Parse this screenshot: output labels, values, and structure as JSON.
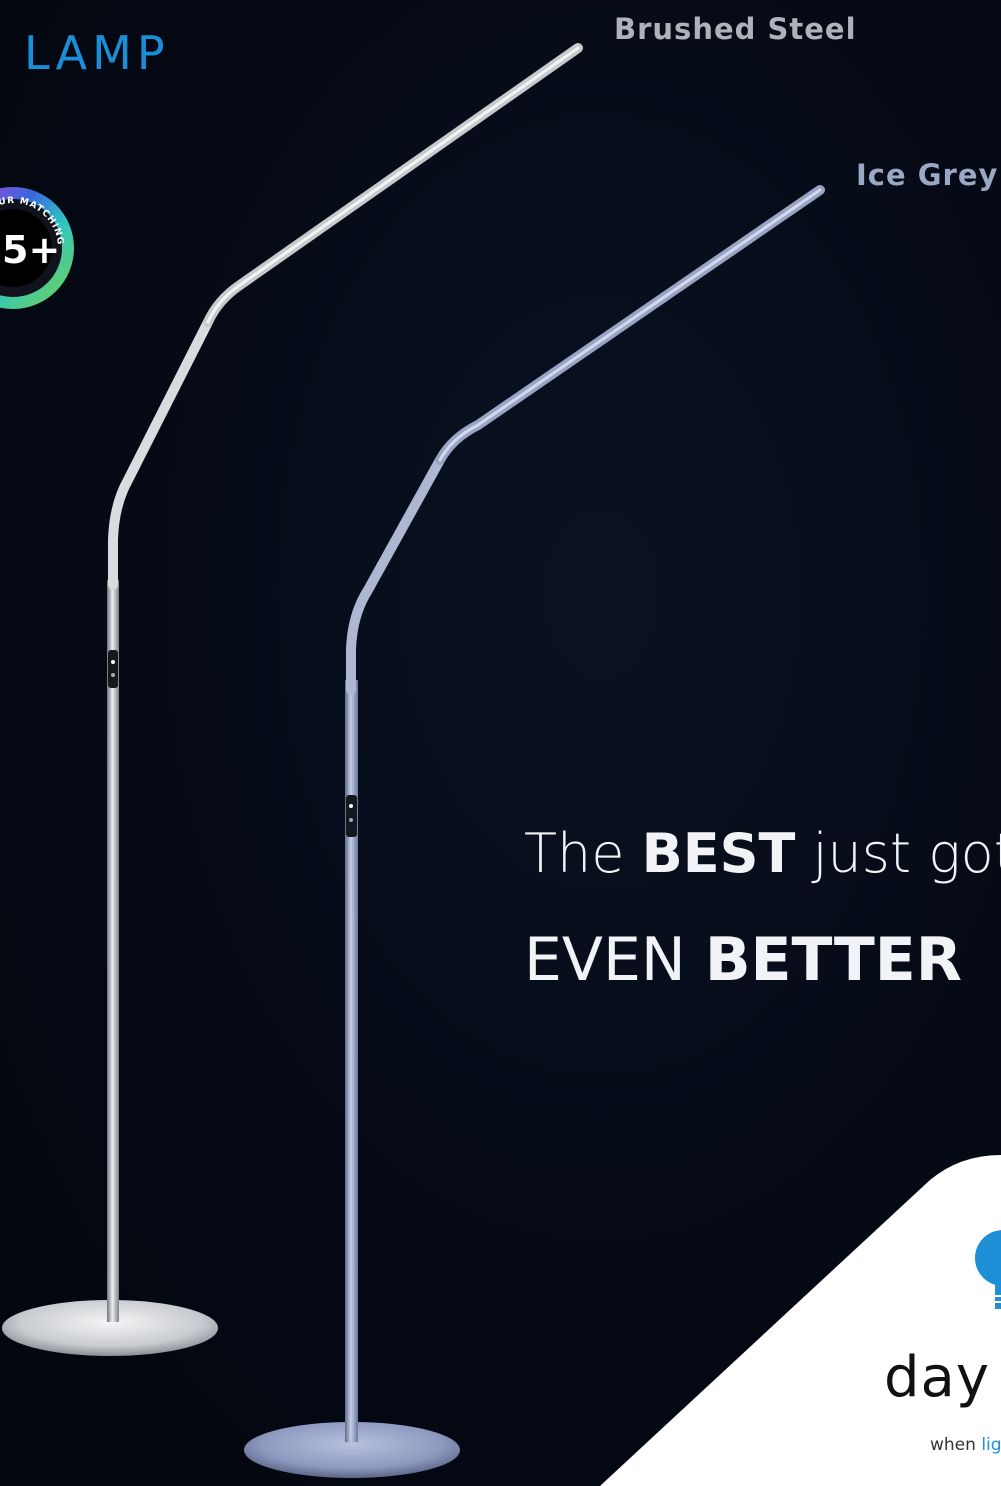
{
  "header": {
    "title": "LAMP"
  },
  "finishes": [
    {
      "label": "Brushed Steel"
    },
    {
      "label": "Ice Grey"
    }
  ],
  "tagline": {
    "line1_pre": "The ",
    "line1_bold": "BEST",
    "line1_post": " just got",
    "line2_pre": "EVEN ",
    "line2_bold": "BETTER"
  },
  "badge": {
    "ring_text": "UR MATCHING",
    "center_text": "5+"
  },
  "logo": {
    "word": "day",
    "sub_pre": "when ",
    "sub_hl": "lig",
    "icon": "lightbulb-icon"
  },
  "colors": {
    "background": "#050a16",
    "brand_blue": "#1a8fd8",
    "steel": "#b9bcc2",
    "ice_grey": "#8e9cc4"
  }
}
